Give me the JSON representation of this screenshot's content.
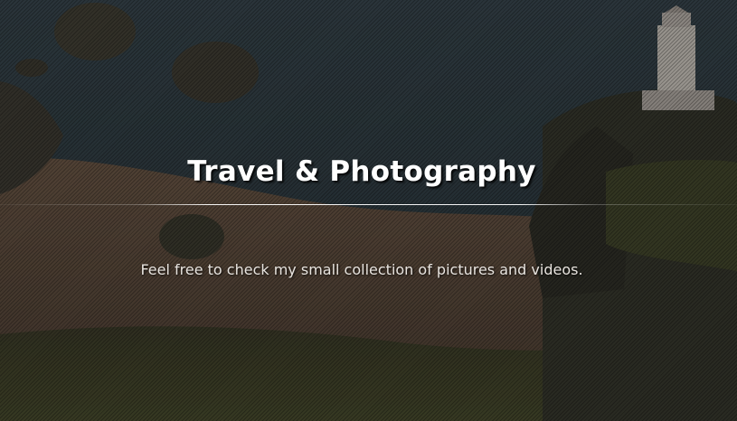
{
  "hero": {
    "title": "Travel & Photography",
    "subtitle": "Feel free to check my small collection of pictures and videos."
  },
  "colors": {
    "title_text": "#ffffff",
    "subtitle_text": "#e8e4df",
    "sea": "#2f3d44",
    "sand": "#5a4a3a",
    "grass": "#3c3f26"
  }
}
